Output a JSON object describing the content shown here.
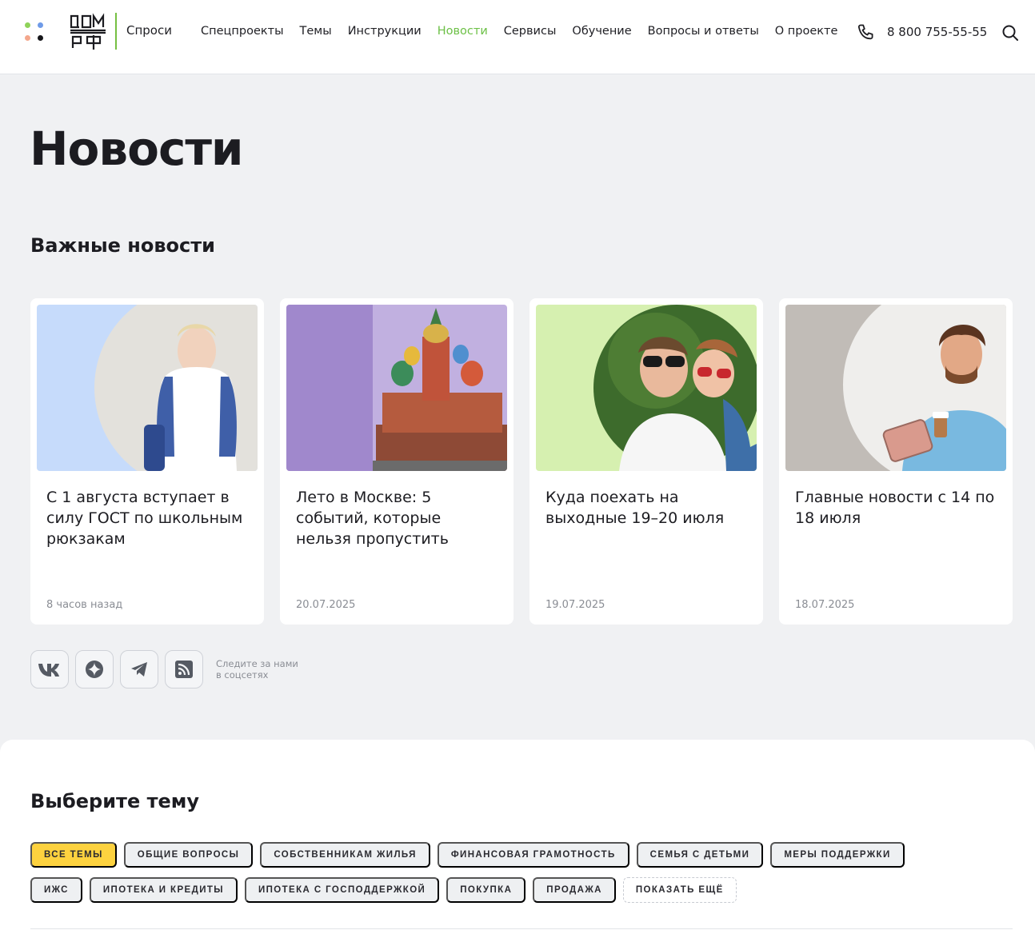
{
  "header": {
    "logo_alt": "ДОМ.РФ",
    "logo_text": "Спроси",
    "nav": [
      {
        "label": "Спецпроекты",
        "active": false
      },
      {
        "label": "Темы",
        "active": false
      },
      {
        "label": "Инструкции",
        "active": false
      },
      {
        "label": "Новости",
        "active": true
      },
      {
        "label": "Сервисы",
        "active": false
      },
      {
        "label": "Обучение",
        "active": false
      },
      {
        "label": "Вопросы и ответы",
        "active": false
      },
      {
        "label": "О проекте",
        "active": false
      }
    ],
    "phone": "8 800 755-55-55"
  },
  "page": {
    "title": "Новости",
    "section_title": "Важные новости"
  },
  "cards": [
    {
      "title": "С 1 августа вступает в силу ГОСТ по школьным рюкзакам",
      "date": "8 часов назад",
      "image": "boy-with-backpack"
    },
    {
      "title": "Лето в Москве: 5 событий, которые нельзя пропустить",
      "date": "20.07.2025",
      "image": "st-basil-cathedral"
    },
    {
      "title": "Куда поехать на выходные 19–20 июля",
      "date": "19.07.2025",
      "image": "couple-on-grass"
    },
    {
      "title": "Главные новости с 14 по 18 июля",
      "date": "18.07.2025",
      "image": "man-with-tablet"
    }
  ],
  "social": {
    "icons": [
      "vk-icon",
      "dzen-icon",
      "telegram-icon",
      "rss-icon"
    ],
    "note_line1": "Следите за нами",
    "note_line2": "в соцсетях"
  },
  "topics": {
    "title": "Выберите тему",
    "chips": [
      {
        "label": "Все темы",
        "active": true
      },
      {
        "label": "Общие вопросы",
        "active": false
      },
      {
        "label": "Собственникам жилья",
        "active": false
      },
      {
        "label": "Финансовая грамотность",
        "active": false
      },
      {
        "label": "Семья с детьми",
        "active": false
      },
      {
        "label": "Меры поддержки",
        "active": false
      },
      {
        "label": "ИЖС",
        "active": false
      },
      {
        "label": "Ипотека и кредиты",
        "active": false
      },
      {
        "label": "Ипотека с господдержкой",
        "active": false
      },
      {
        "label": "Покупка",
        "active": false
      },
      {
        "label": "Продажа",
        "active": false
      }
    ],
    "more_label": "Показать ещё"
  },
  "colors": {
    "accent_green": "#6cc046",
    "accent_yellow": "#fdd23f",
    "background": "#f0f1f3"
  }
}
